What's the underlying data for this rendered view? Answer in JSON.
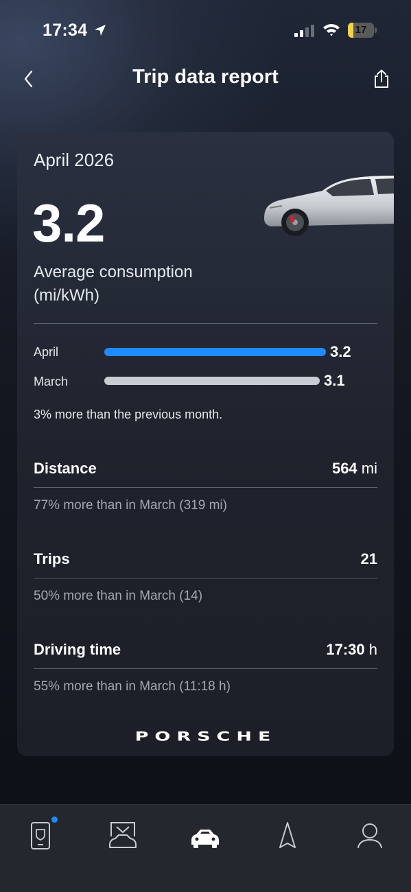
{
  "status_bar": {
    "time": "17:34",
    "battery_level": "17",
    "battery_color": "#f6d23c"
  },
  "header": {
    "title": "Trip data report",
    "back_icon": "chevron-left-icon",
    "share_icon": "share-icon"
  },
  "report": {
    "month": "April 2026",
    "average_value": "3.2",
    "average_label_line1": "Average consumption",
    "average_label_line2": "(mi/kWh)",
    "comparison": [
      {
        "label": "April",
        "value": "3.2",
        "fraction": 0.993,
        "color": "#1e8bff"
      },
      {
        "label": "March",
        "value": "3.1",
        "fraction": 0.965,
        "color": "#c9ccd2"
      }
    ],
    "comparison_text": "3% more than the previous month.",
    "stats": [
      {
        "label": "Distance",
        "value": "564",
        "unit": " mi",
        "note": "77% more than in March (319 mi)"
      },
      {
        "label": "Trips",
        "value": "21",
        "unit": "",
        "note": "50% more than in March (14)"
      },
      {
        "label": "Driving time",
        "value": "17:30",
        "unit": " h",
        "note": "55% more than in March (11:18 h)"
      }
    ],
    "brand": "PORSCHE"
  },
  "bottom_nav": {
    "items": [
      {
        "icon": "phone-key-icon",
        "has_badge": true,
        "active": false
      },
      {
        "icon": "car-garage-icon",
        "has_badge": false,
        "active": false
      },
      {
        "icon": "car-front-icon",
        "has_badge": false,
        "active": true
      },
      {
        "icon": "navigation-arrow-icon",
        "has_badge": false,
        "active": false
      },
      {
        "icon": "profile-icon",
        "has_badge": false,
        "active": false
      }
    ],
    "badge_color": "#1e8bff"
  }
}
